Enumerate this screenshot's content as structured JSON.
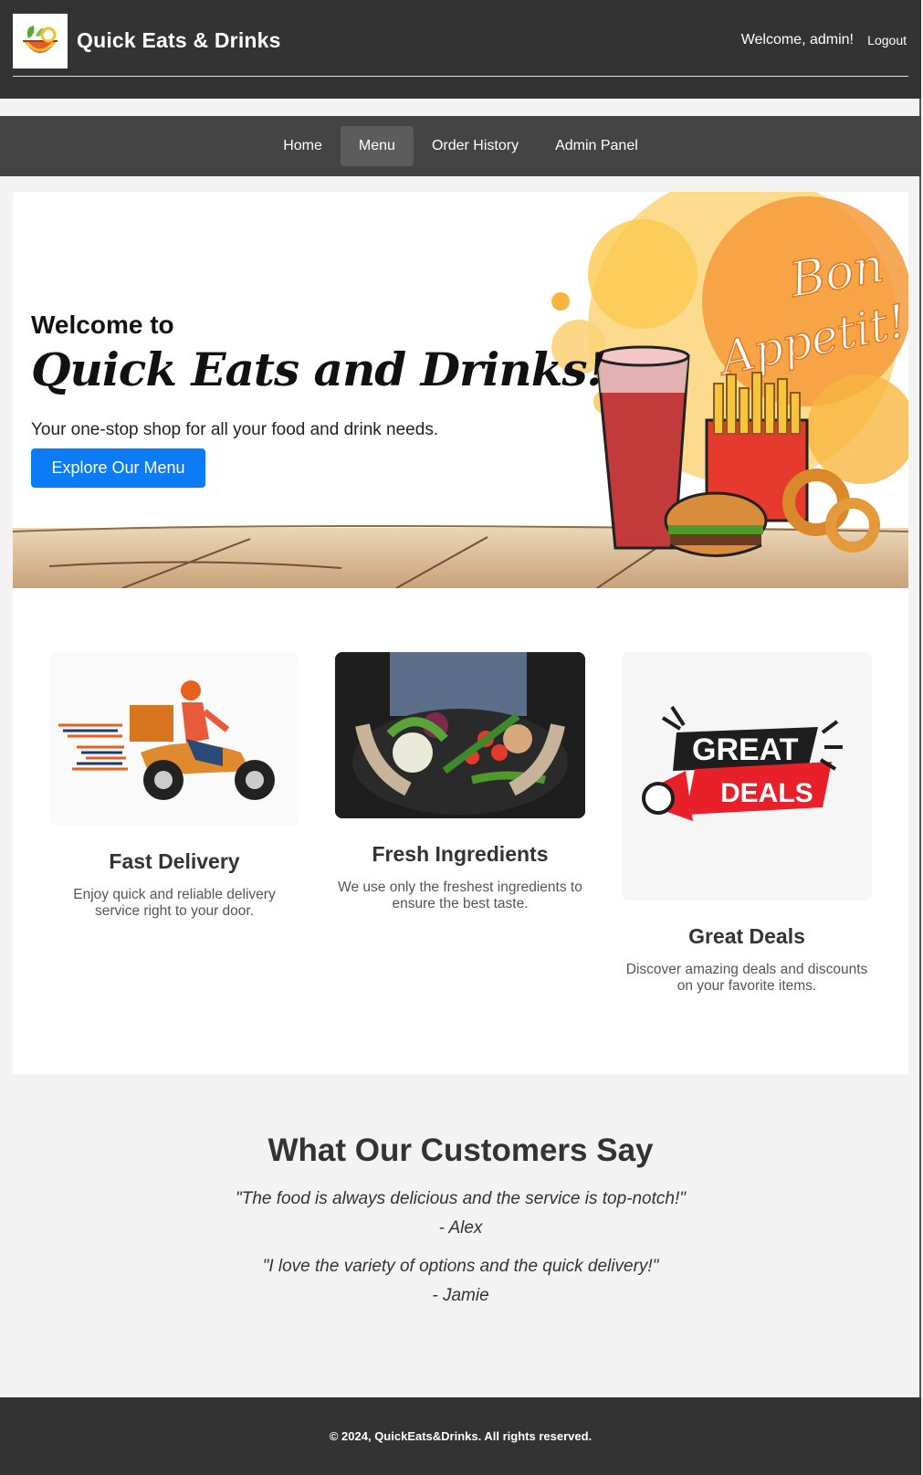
{
  "header": {
    "brand": "Quick Eats & Drinks",
    "welcome_text": "Welcome, admin!",
    "logout_label": "Logout"
  },
  "nav": {
    "items": [
      {
        "label": "Home"
      },
      {
        "label": "Menu",
        "active": true
      },
      {
        "label": "Order History"
      },
      {
        "label": "Admin Panel"
      }
    ]
  },
  "hero": {
    "welcome": "Welcome to",
    "title": "Quick Eats and Drinks!",
    "subtitle": "Your one-stop shop for all your food and drink needs.",
    "cta_label": "Explore Our Menu",
    "art_text_line1": "Bon",
    "art_text_line2": "Appetit!"
  },
  "features": [
    {
      "title": "Fast Delivery",
      "description": "Enjoy quick and reliable delivery service right to your door."
    },
    {
      "title": "Fresh Ingredients",
      "description": "We use only the freshest ingredients to ensure the best taste."
    },
    {
      "title": "Great Deals",
      "description": "Discover amazing deals and discounts on your favorite items.",
      "badge_line1": "GREAT",
      "badge_line2": "DEALS"
    }
  ],
  "testimonials": {
    "heading": "What Our Customers Say",
    "items": [
      {
        "quote": "\"The food is always delicious and the service is top-notch!\"",
        "author": "- Alex"
      },
      {
        "quote": "\"I love the variety of options and the quick delivery!\"",
        "author": "- Jamie"
      }
    ]
  },
  "footer": {
    "text": "© 2024, QuickEats&Drinks. All rights reserved."
  },
  "colors": {
    "header_bg": "#333333",
    "nav_bg": "#444444",
    "nav_active_bg": "#5c5c5c",
    "cta_bg": "#0b7cf6",
    "page_bg": "#f3f3f3"
  }
}
